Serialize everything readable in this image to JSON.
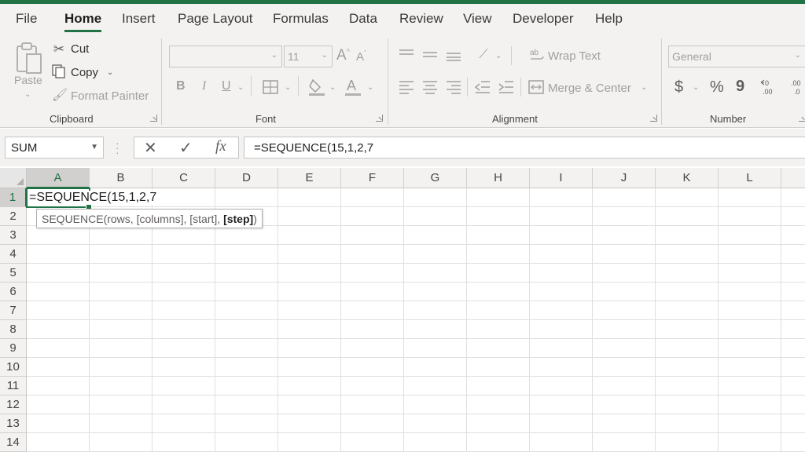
{
  "menu": {
    "tabs": [
      {
        "label": "File"
      },
      {
        "label": "Home"
      },
      {
        "label": "Insert"
      },
      {
        "label": "Page Layout"
      },
      {
        "label": "Formulas"
      },
      {
        "label": "Data"
      },
      {
        "label": "Review"
      },
      {
        "label": "View"
      },
      {
        "label": "Developer"
      },
      {
        "label": "Help"
      }
    ],
    "active_tab": "Home"
  },
  "ribbon": {
    "clipboard": {
      "label": "Clipboard",
      "paste": "Paste",
      "cut": "Cut",
      "copy": "Copy",
      "format_painter": "Format Painter"
    },
    "font": {
      "label": "Font",
      "font_name": "",
      "font_size": "11",
      "bold": "B",
      "italic": "I",
      "underline": "U"
    },
    "alignment": {
      "label": "Alignment",
      "wrap_text": "Wrap Text",
      "merge_center": "Merge & Center"
    },
    "number": {
      "label": "Number",
      "format": "General",
      "currency": "$",
      "percent": "%",
      "comma": "9"
    }
  },
  "formula_bar": {
    "name_box": "SUM",
    "cancel": "✕",
    "enter": "✓",
    "fx": "fx",
    "formula": "=SEQUENCE(15,1,2,7"
  },
  "grid": {
    "columns": [
      "A",
      "B",
      "C",
      "D",
      "E",
      "F",
      "G",
      "H",
      "I",
      "J",
      "K",
      "L"
    ],
    "rows": [
      "1",
      "2",
      "3",
      "4",
      "5",
      "6",
      "7",
      "8",
      "9",
      "10",
      "11",
      "12",
      "13",
      "14"
    ],
    "active_cell": "A1",
    "active_cell_value": "=SEQUENCE(15,1,2,7",
    "tooltip": {
      "prefix": "SEQUENCE(rows, [columns], [start], ",
      "current_arg": "[step]",
      "suffix": ")"
    }
  },
  "colors": {
    "accent": "#217346",
    "ribbon_bg": "#f3f2f1",
    "gridline": "#e1dfdd"
  }
}
